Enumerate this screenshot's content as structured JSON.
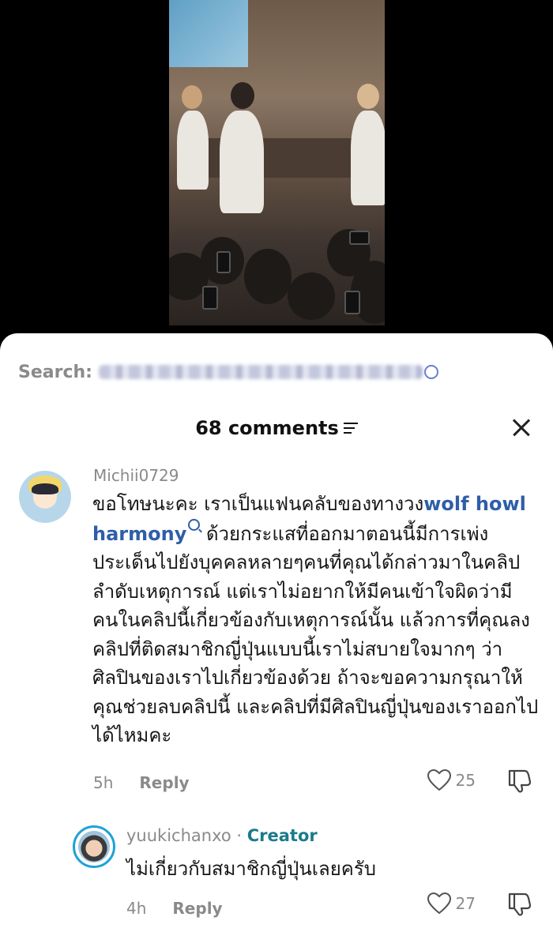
{
  "search": {
    "label": "Search:"
  },
  "header": {
    "comments_count": "68 comments"
  },
  "comments": [
    {
      "username": "Michii0729",
      "text_before_link": "ขอโทษนะคะ เราเป็นแฟนคลับของทางวง",
      "link_text": "wolf howl harmony",
      "text_after_link": " ด้วยกระแสที่ออกมาตอนนี้มีการเพ่งประเด็นไปยังบุคคลหลายๆคนที่คุณได้กล่าวมาในคลิปลำดับเหตุการณ์ แต่เราไม่อยากให้มีคนเข้าใจผิดว่ามีคนในคลิปนี้เกี่ยวข้องกับเหตุการณ์นั้น แล้วการที่คุณลงคลิปที่ติดสมาชิกญี่ปุ่นแบบนี้เราไม่สบายใจมากๆ ว่าศิลปินของเราไปเกี่ยวข้องด้วย ถ้าจะขอความกรุณาให้คุณช่วยลบคลิปนี้ และคลิปที่มีศิลปินญี่ปุ่นของเราออกไปได้ไหมคะ",
      "time": "5h",
      "reply_label": "Reply",
      "likes": "25"
    }
  ],
  "replies": [
    {
      "username": "yuukichanxo",
      "separator": " · ",
      "badge": "Creator",
      "text": "ไม่เกี่ยวกับสมาชิกญี่ปุ่นเลยครับ",
      "time": "4h",
      "reply_label": "Reply",
      "likes": "27"
    }
  ],
  "colors": {
    "link": "#2f5ea8",
    "creator_badge": "#1b7a8c",
    "avatar_ring": "#1ea1d8"
  }
}
